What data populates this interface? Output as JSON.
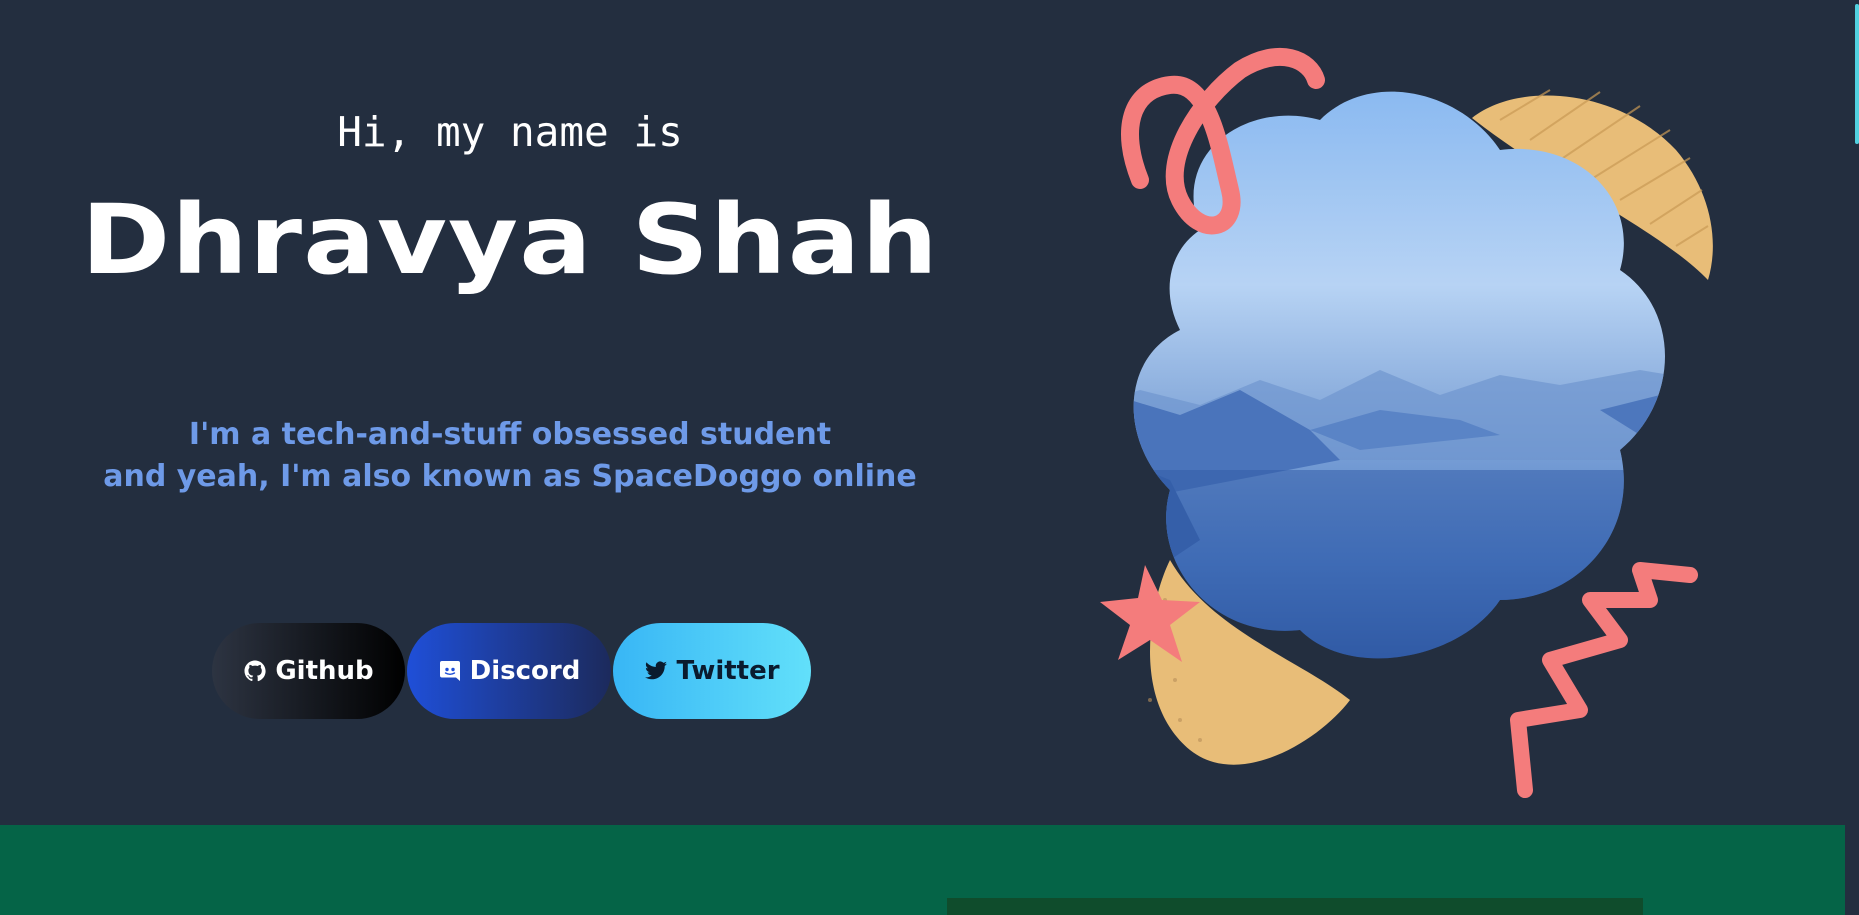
{
  "hero": {
    "greeting": "Hi, my name is",
    "name": "Dhravya Shah",
    "tagline_line1": "I'm a tech-and-stuff obsessed student",
    "tagline_line2": "and yeah, I'm also known as SpaceDoggo online"
  },
  "socials": [
    {
      "label": "Github",
      "icon": "github-icon"
    },
    {
      "label": "Discord",
      "icon": "discord-icon"
    },
    {
      "label": "Twitter",
      "icon": "twitter-icon"
    }
  ],
  "colors": {
    "background": "#232e3f",
    "tagline": "#6e9ae8",
    "accent_coral": "#f47c7c",
    "accent_sand": "#e8bd78",
    "lower_section": "#056447"
  },
  "illustration": {
    "shapes": [
      "coral-loop-icon",
      "sand-leaf-blob",
      "landscape-cloud-image",
      "coral-star-icon",
      "coral-zigzag-icon"
    ]
  }
}
